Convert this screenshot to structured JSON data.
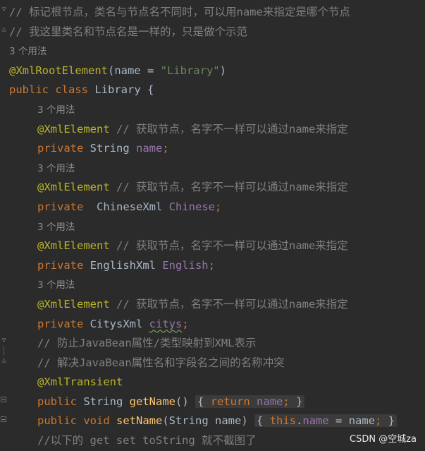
{
  "colors": {
    "background": "#2b2b2b",
    "comment": "#808080",
    "keyword": "#cc7832",
    "annotation": "#bbb529",
    "string": "#6a8759",
    "field": "#9876aa",
    "method": "#ffc66d",
    "text": "#a9b7c6"
  },
  "code": {
    "comment1": "// 标记根节点，类名与节点名不同时，可以用name来指定是哪个节点",
    "comment2": "// 我这里类名和节点名是一样的，只是做个示范",
    "usage_root": "3 个用法",
    "root_annotation": "@XmlRootElement",
    "root_open": "(name = ",
    "root_value": "\"Library\"",
    "root_close": ")",
    "class_public": "public",
    "class_kw": "class",
    "class_name": "Library {",
    "fields": [
      {
        "usage": "3 个用法",
        "annotation": "@XmlElement",
        "comment": " // 获取节点，名字不一样可以通过name来指定",
        "modifier": "private",
        "type": " String ",
        "name": "name",
        "semi": ";"
      },
      {
        "usage": "3 个用法",
        "annotation": "@XmlElement",
        "comment": " // 获取节点，名字不一样可以通过name来指定",
        "modifier": "private",
        "type": "  ChineseXml ",
        "name": "Chinese",
        "semi": ";"
      },
      {
        "usage": "3 个用法",
        "annotation": "@XmlElement",
        "comment": " // 获取节点，名字不一样可以通过name来指定",
        "modifier": "private",
        "type": " EnglishXml ",
        "name": "English",
        "semi": ";"
      },
      {
        "usage": "3 个用法",
        "annotation": "@XmlElement",
        "comment": " // 获取节点，名字不一样可以通过name来指定",
        "modifier": "private",
        "type": " CitysXml ",
        "name": "citys",
        "semi": ";"
      }
    ],
    "comment3": "// 防止JavaBean属性/类型映射到XML表示",
    "comment4": "// 解决JavaBean属性名和字段名之间的名称冲突",
    "transient_annotation": "@XmlTransient",
    "getter": {
      "public": "public",
      "type": " String ",
      "method": "getName",
      "parens": "()",
      "open": "{",
      "ret": "return",
      "field": "name",
      "semi": ";",
      "close": "}"
    },
    "setter": {
      "public": "public",
      "void": "void",
      "method": "setName",
      "params": "(String name)",
      "open": "{",
      "this": "this",
      "dot": ".",
      "field": "name",
      "assign": " = name",
      "semi": ";",
      "close": "}"
    },
    "comment5": "//以下的 get set toString 就不截图了"
  },
  "watermark": "CSDN @空城za"
}
